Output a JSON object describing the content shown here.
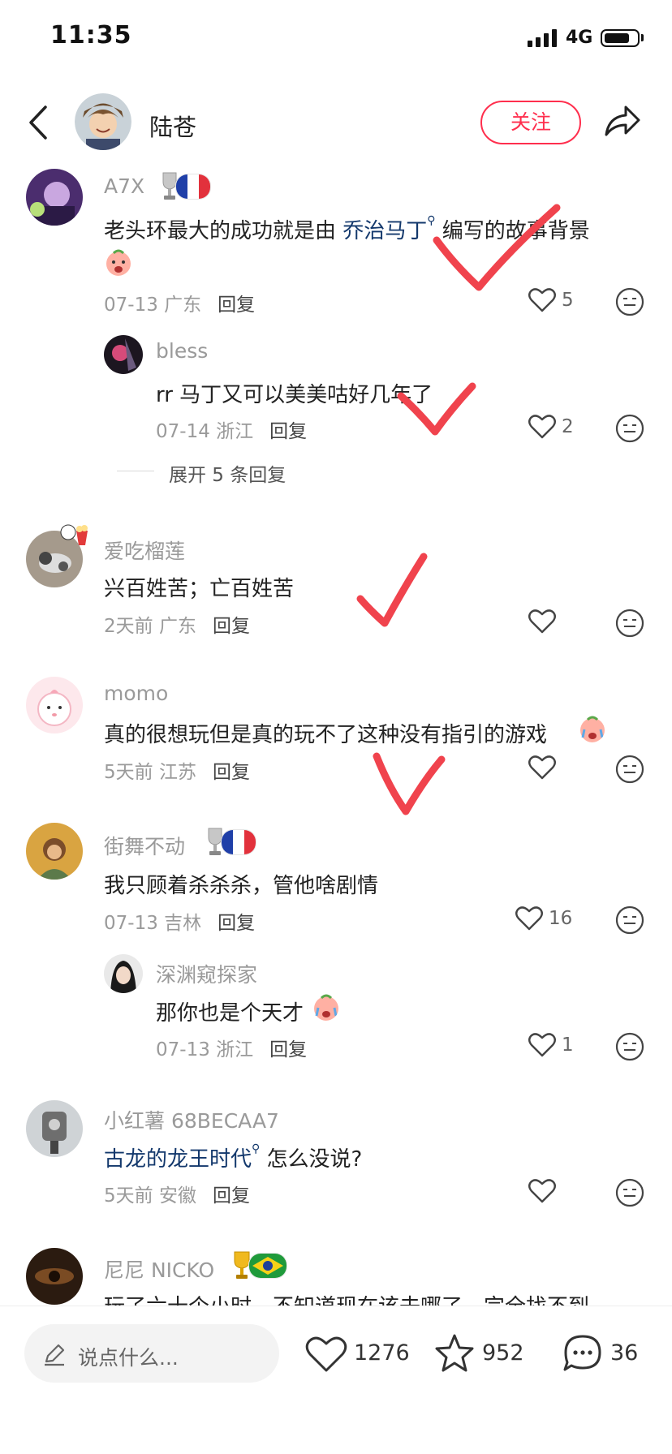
{
  "status_bar": {
    "time": "11:35",
    "network": "4G"
  },
  "header": {
    "username": "陆苍",
    "follow_label": "关注"
  },
  "comments": [
    {
      "user": "A7X",
      "text_pre": "老头环最大的成功就是由 ",
      "link": "乔治马丁",
      "text_post": " 编写的故事背景",
      "meta": "07-13 广东",
      "reply": "回复",
      "likes": "5"
    },
    {
      "user": "bless",
      "text": "rr 马丁又可以美美咕好几年了",
      "meta": "07-14 浙江",
      "reply": "回复",
      "likes": "2"
    },
    {
      "user": "爱吃榴莲",
      "text": "兴百姓苦；亡百姓苦",
      "meta": "2天前 广东",
      "reply": "回复"
    },
    {
      "user": "momo",
      "text": "真的很想玩但是真的玩不了这种没有指引的游戏",
      "meta": "5天前 江苏",
      "reply": "回复"
    },
    {
      "user": "街舞不动",
      "text": "我只顾着杀杀杀，管他啥剧情",
      "meta": "07-13 吉林",
      "reply": "回复",
      "likes": "16"
    },
    {
      "user": "深渊窥探家",
      "text": "那你也是个天才",
      "meta": "07-13 浙江",
      "reply": "回复",
      "likes": "1"
    },
    {
      "user": "小红薯 68BECAA7",
      "link": "古龙的龙王时代",
      "text_post": " 怎么没说?",
      "meta": "5天前 安徽",
      "reply": "回复"
    },
    {
      "user": "尼尼 NICKO",
      "text": "玩了六十个小时，不知道现在该去哪了，完全找不到"
    }
  ],
  "expand_replies": "展开 5 条回复",
  "bottom_bar": {
    "placeholder": "说点什么...",
    "likes": "1276",
    "stars": "952",
    "comments": "36"
  },
  "colors": {
    "accent": "#ff2e4d",
    "link": "#13386c",
    "check_marks": "#f0434d"
  }
}
